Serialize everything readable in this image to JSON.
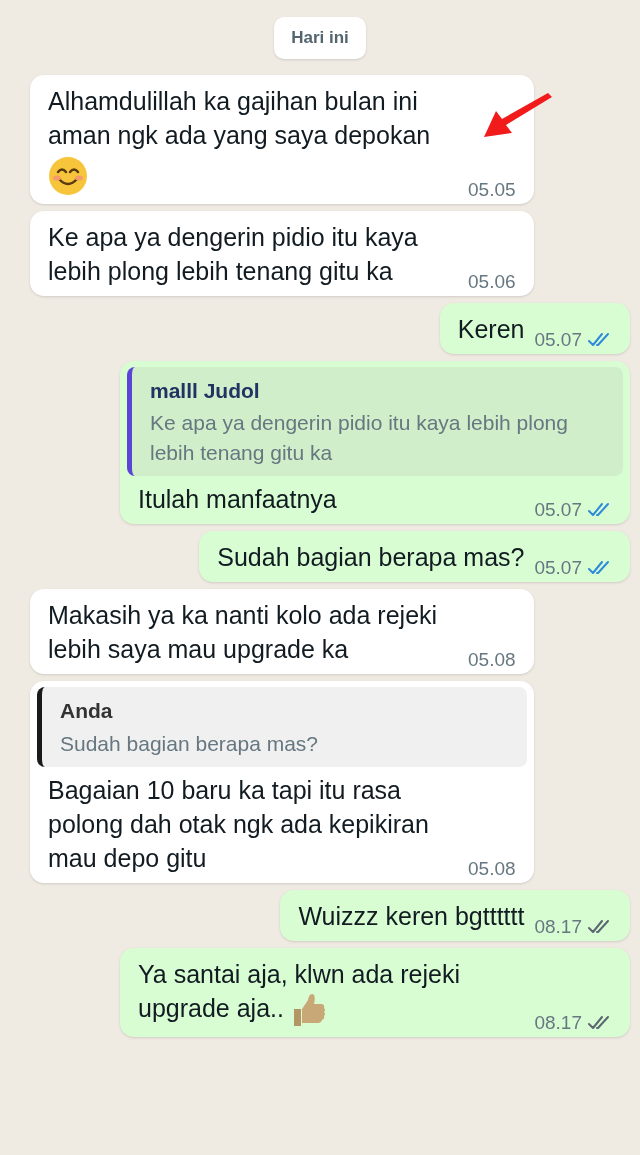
{
  "date_chip": "Hari ini",
  "messages": [
    {
      "kind": "incoming",
      "text": "Alhamdulillah ka gajihan bulan ini aman ngk ada yang saya depokan",
      "emoji": {
        "kind": "smiling-face"
      },
      "time": "05.05",
      "arrow_marker": true
    },
    {
      "kind": "incoming",
      "text": "Ke apa ya dengerin pidio itu kaya lebih plong lebih tenang gitu ka",
      "time": "05.06"
    },
    {
      "kind": "outgoing",
      "text": "Keren",
      "time": "05.07",
      "read": true
    },
    {
      "kind": "outgoing",
      "quote": {
        "author": "malll Judol",
        "text": "Ke apa ya dengerin pidio itu kaya lebih plong lebih tenang gitu ka"
      },
      "text": "Itulah manfaatnya",
      "time": "05.07",
      "read": true
    },
    {
      "kind": "outgoing",
      "text": "Sudah bagian berapa mas?",
      "time": "05.07",
      "read": true
    },
    {
      "kind": "incoming",
      "text": "Makasih ya ka nanti kolo ada rejeki lebih saya mau upgrade ka",
      "time": "05.08"
    },
    {
      "kind": "incoming",
      "quote": {
        "author": "Anda",
        "text": "Sudah bagian berapa mas?"
      },
      "text": "Bagaian 10 baru ka tapi itu rasa polong dah otak ngk ada kepikiran mau depo gitu",
      "time": "05.08"
    },
    {
      "kind": "outgoing",
      "text": "Wuizzz keren bgtttttt",
      "time": "08.17",
      "read": false
    },
    {
      "kind": "outgoing",
      "text": "Ya santai aja, klwn ada rejeki upgrade aja..",
      "emoji": {
        "kind": "thumbs-up"
      },
      "time": "08.17",
      "read": false
    }
  ]
}
